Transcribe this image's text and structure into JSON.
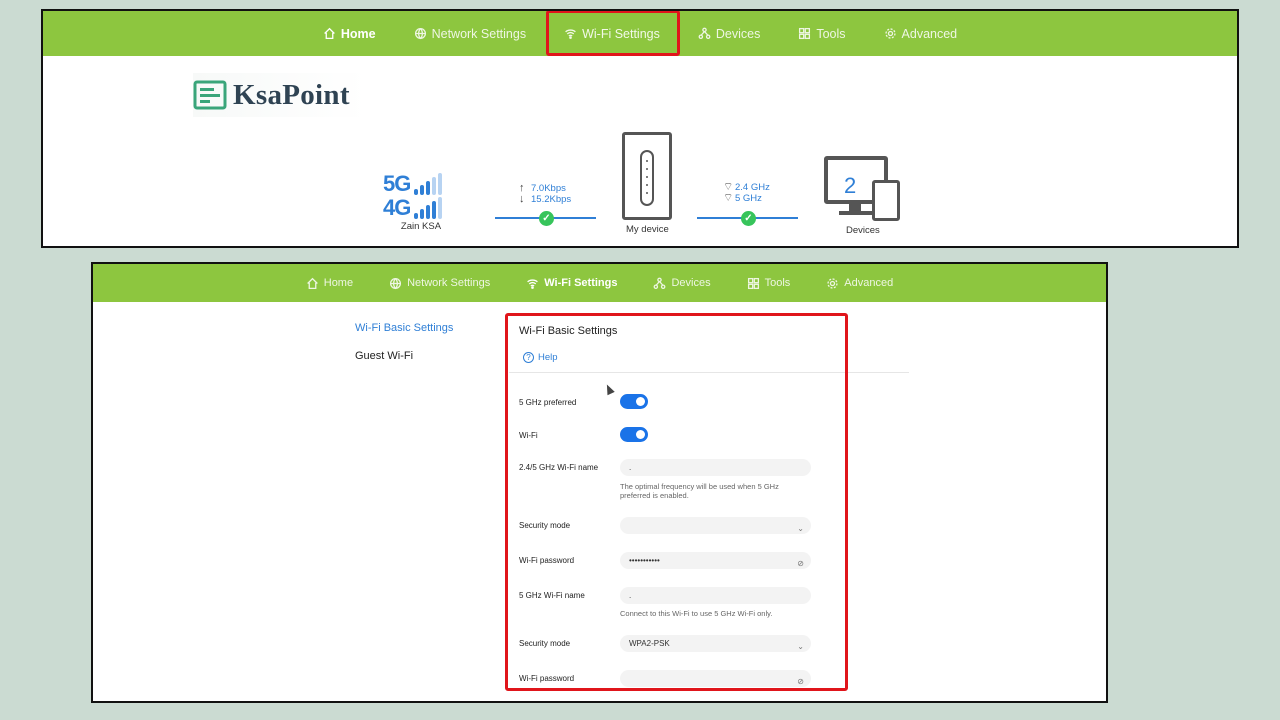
{
  "top_nav": {
    "items": [
      {
        "label": "Home",
        "icon": "home-icon"
      },
      {
        "label": "Network Settings",
        "icon": "globe-icon"
      },
      {
        "label": "Wi-Fi Settings",
        "icon": "wifi-icon"
      },
      {
        "label": "Devices",
        "icon": "devices-icon"
      },
      {
        "label": "Tools",
        "icon": "tools-icon"
      },
      {
        "label": "Advanced",
        "icon": "gear-icon"
      }
    ]
  },
  "logo": {
    "text": "KsaPoint"
  },
  "status": {
    "network_5g": "5G",
    "network_4g": "4G",
    "carrier": "Zain KSA",
    "upload_rate": "7.0Kbps",
    "download_rate": "15.2Kbps",
    "my_device_label": "My device",
    "band_24": "2.4 GHz",
    "band_5": "5 GHz",
    "device_count": "2",
    "devices_label": "Devices"
  },
  "bottom_nav": {
    "items": [
      {
        "label": "Home",
        "icon": "home-icon"
      },
      {
        "label": "Network Settings",
        "icon": "globe-icon"
      },
      {
        "label": "Wi-Fi Settings",
        "icon": "wifi-icon"
      },
      {
        "label": "Devices",
        "icon": "devices-icon"
      },
      {
        "label": "Tools",
        "icon": "tools-icon"
      },
      {
        "label": "Advanced",
        "icon": "gear-icon"
      }
    ]
  },
  "sidebar": {
    "items": [
      {
        "label": "Wi-Fi Basic Settings",
        "active": true
      },
      {
        "label": "Guest Wi-Fi",
        "active": false
      }
    ]
  },
  "panel": {
    "title": "Wi-Fi Basic Settings",
    "help_label": "Help",
    "fields": {
      "pref5_label": "5 GHz preferred",
      "pref5_on": true,
      "wifi_label": "Wi-Fi",
      "wifi_on": true,
      "name24_label": "2.4/5 GHz Wi-Fi name",
      "name24_value": ".",
      "name24_hint": "The optimal frequency will be used when 5 GHz preferred is enabled.",
      "sec1_label": "Security mode",
      "sec1_value": "",
      "pw1_label": "Wi-Fi password",
      "pw1_value": "•••••••••••",
      "name5_label": "5 GHz Wi-Fi name",
      "name5_value": ".",
      "name5_hint": "Connect to this Wi-Fi to use 5 GHz Wi-Fi only.",
      "sec2_label": "Security mode",
      "sec2_value": "WPA2-PSK",
      "pw2_label": "Wi-Fi password",
      "pw2_value": ""
    }
  },
  "colors": {
    "nav_green": "#8dc63f",
    "accent_blue": "#2f7fd6",
    "toggle_blue": "#1a73e8",
    "highlight_red": "#e0151b",
    "check_green": "#37c45b"
  }
}
